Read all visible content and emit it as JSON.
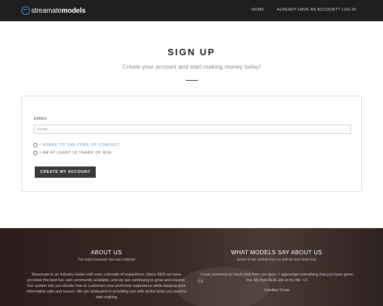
{
  "header": {
    "logo_part1": "streamate",
    "logo_part2": "models",
    "nav": [
      "HOME",
      "ALREADY HAVE AN ACCOUNT? LOG IN"
    ]
  },
  "signup": {
    "title": "SIGN UP",
    "subtitle": "Create your account and start making money today!",
    "email_label": "EMAIL",
    "email_placeholder": "Email",
    "email_value": "",
    "checkbox_conduct": "I AGREE TO THE CODE OF CONDUCT",
    "checkbox_age": "I AM AT LEAST 18 YEARS OF AGE",
    "submit_label": "CREATE MY ACCOUNT"
  },
  "footer": {
    "about_title": "ABOUT US",
    "about_subtitle": "The most exclusive live cam network",
    "about_body": "Streamate is an industry leader with over a decade of experience. Since 2003 we have provided the best live cam community available, and we are continuing to grow and expand. Our system lets you decide how to customize your performer experience while keeping your information safe and secure. We are dedicated to providing you with all the tools you need to start making",
    "testimonials_title": "WHAT MODELS SAY ABOUT US",
    "testimonials_subtitle": "Some of our models love us and we love them too!",
    "testimonial_text": "I have received so much help from you guys. I appreciate everything that you have given me. My first REAL job in my life. <3",
    "testimonial_author": "Candise Snow"
  }
}
